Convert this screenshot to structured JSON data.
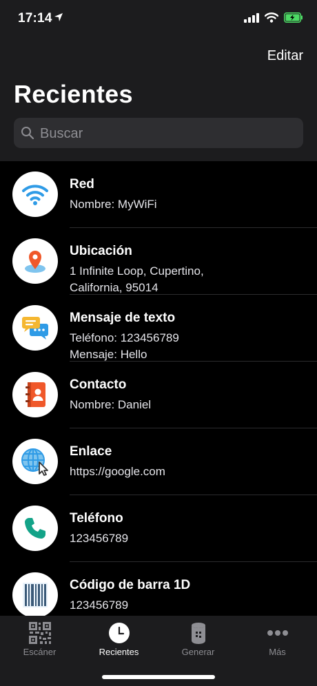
{
  "status": {
    "time": "17:14"
  },
  "header": {
    "edit_label": "Editar",
    "title": "Recientes"
  },
  "search": {
    "placeholder": "Buscar"
  },
  "items": [
    {
      "icon": "wifi-icon",
      "title": "Red",
      "subtitle": "Nombre: MyWiFi"
    },
    {
      "icon": "location-pin-icon",
      "title": "Ubicación",
      "subtitle": "1 Infinite Loop, Cupertino,\nCalifornia, 95014"
    },
    {
      "icon": "chat-bubbles-icon",
      "title": "Mensaje de texto",
      "subtitle": "Teléfono: 123456789\nMensaje: Hello"
    },
    {
      "icon": "contact-book-icon",
      "title": "Contacto",
      "subtitle": "Nombre: Daniel"
    },
    {
      "icon": "globe-cursor-icon",
      "title": "Enlace",
      "subtitle": "https://google.com"
    },
    {
      "icon": "phone-icon",
      "title": "Teléfono",
      "subtitle": "123456789"
    },
    {
      "icon": "barcode-icon",
      "title": "Código de barra 1D",
      "subtitle": "123456789"
    }
  ],
  "tabs": [
    {
      "label": "Escáner",
      "icon": "qr-code-icon",
      "active": false
    },
    {
      "label": "Recientes",
      "icon": "clock-icon",
      "active": true
    },
    {
      "label": "Generar",
      "icon": "paint-bucket-icon",
      "active": false
    },
    {
      "label": "Más",
      "icon": "more-dots-icon",
      "active": false
    }
  ],
  "colors": {
    "accent_blue": "#2f9be6",
    "background": "#000000",
    "bar": "#1c1c1e",
    "battery_green": "#4cd964"
  }
}
